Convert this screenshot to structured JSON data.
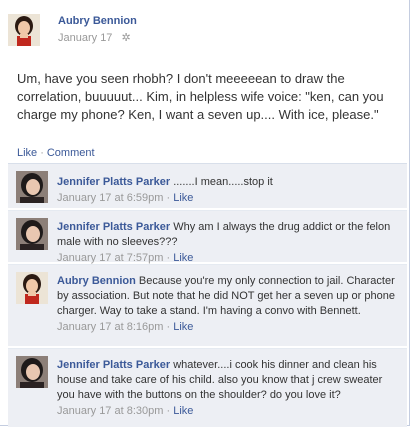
{
  "post": {
    "author": "Aubry Bennion",
    "date": "January 17",
    "privacy_icon": "gear-icon",
    "body": "Um, have you seen rhobh? I don't meeeeean to draw the correlation, buuuuut... Kim, in helpless wife voice: \"ken, can you charge my phone? Ken, I want a seven up.... With ice, please.\"",
    "actions": {
      "like": "Like",
      "sep": "·",
      "comment": "Comment"
    }
  },
  "comments": [
    {
      "author": "Jennifer Platts Parker",
      "text": ".......I mean.....stop it",
      "time": "January 17 at 6:59pm",
      "sep": "·",
      "like": "Like"
    },
    {
      "author": "Jennifer Platts Parker",
      "text": "Why am I always the drug addict or the felon male with no sleeves???",
      "time": "January 17 at 7:57pm",
      "sep": "·",
      "like": "Like"
    },
    {
      "author": "Aubry Bennion",
      "text": "Because you're my only connection to jail. Character by association. But note that he did NOT get her a seven up or phone charger. Way to take a stand. I'm having a convo with Bennett.",
      "time": "January 17 at 8:16pm",
      "sep": "·",
      "like": "Like"
    },
    {
      "author": "Jennifer Platts Parker",
      "text": "whatever....i cook his dinner and clean his house and take care of his child. also you know that j crew sweater you have with the buttons on the shoulder? do you love it?",
      "time": "January 17 at 8:30pm",
      "sep": "·",
      "like": "Like"
    }
  ],
  "colors": {
    "link": "#3b5998",
    "meta": "#999999",
    "comment_bg": "#edeff4"
  }
}
